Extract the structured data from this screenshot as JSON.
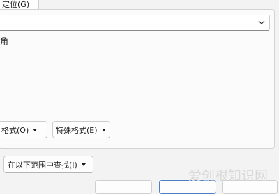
{
  "tabs": {
    "locate_label": "定位(G)"
  },
  "find": {
    "value": "",
    "options_hint": "角"
  },
  "buttons": {
    "format_label": "格式(O)",
    "special_format_label": "特殊格式(E)",
    "search_scope_label": "在以下范围中查找(I)"
  },
  "watermark": {
    "text": "爱创根知识网"
  }
}
